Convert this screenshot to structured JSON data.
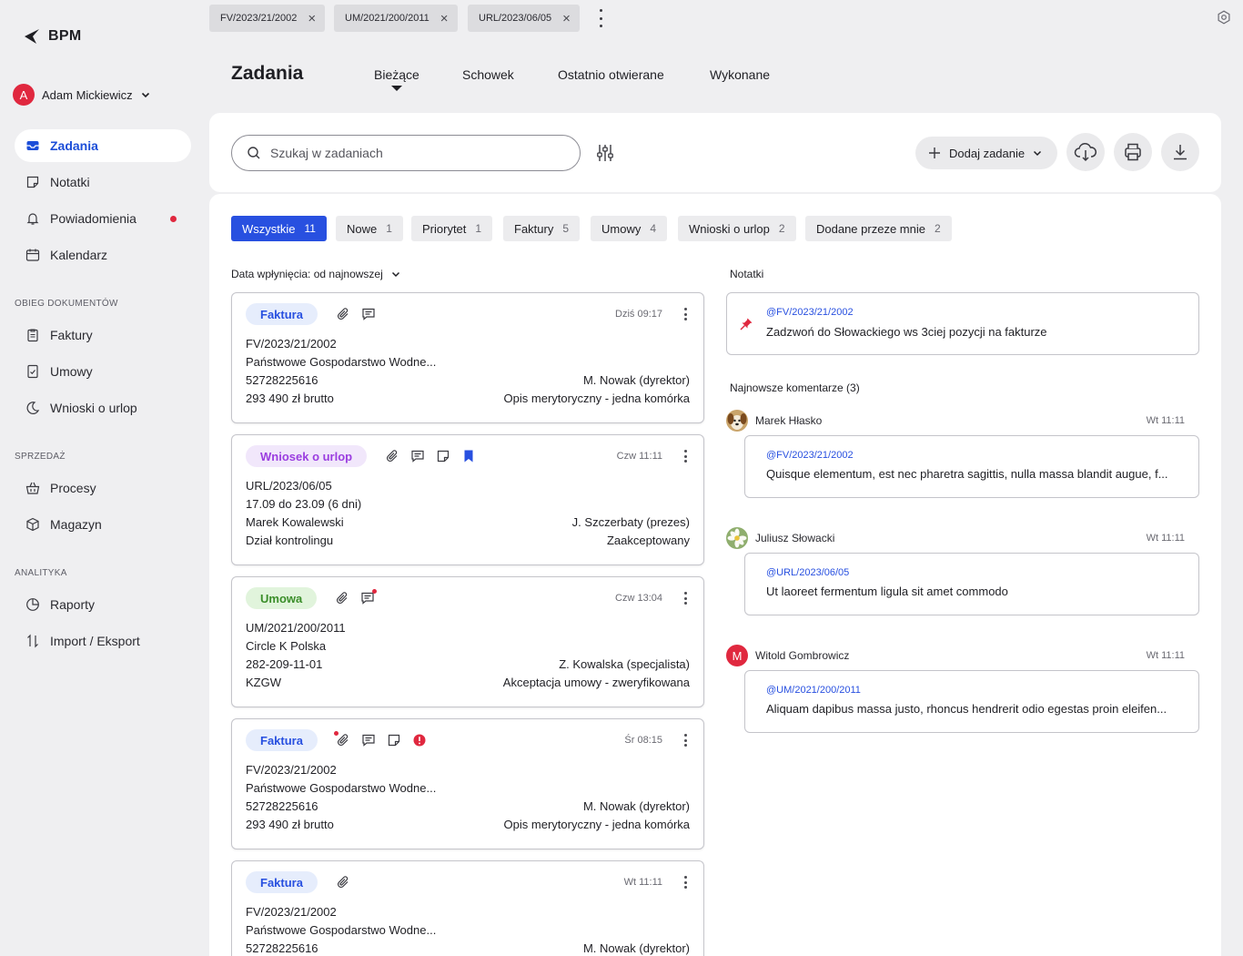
{
  "brand": {
    "name": "BPM",
    "accent": "#2850e0",
    "alert": "#e0283f"
  },
  "user": {
    "initial": "A",
    "name": "Adam Mickiewicz"
  },
  "nav": {
    "main": [
      {
        "label": "Zadania",
        "icon": "inbox-icon",
        "active": true
      },
      {
        "label": "Notatki",
        "icon": "note-icon"
      },
      {
        "label": "Powiadomienia",
        "icon": "bell-icon",
        "has_dot": true
      },
      {
        "label": "Kalendarz",
        "icon": "calendar-icon"
      }
    ],
    "sections": [
      {
        "title": "OBIEG DOKUMENTÓW",
        "items": [
          {
            "label": "Faktury",
            "icon": "clipboard-icon"
          },
          {
            "label": "Umowy",
            "icon": "check-document-icon"
          },
          {
            "label": "Wnioski o urlop",
            "icon": "moon-icon"
          }
        ]
      },
      {
        "title": "SPRZEDAŻ",
        "items": [
          {
            "label": "Procesy",
            "icon": "basket-icon"
          },
          {
            "label": "Magazyn",
            "icon": "box-icon"
          }
        ]
      },
      {
        "title": "ANALITYKA",
        "items": [
          {
            "label": "Raporty",
            "icon": "pie-chart-icon"
          },
          {
            "label": "Import / Eksport",
            "icon": "transfer-icon"
          }
        ]
      }
    ]
  },
  "doc_tabs": [
    "FV/2023/21/2002",
    "UM/2021/200/2011",
    "URL/2023/06/05"
  ],
  "header": {
    "title": "Zadania",
    "tabs": [
      "Bieżące",
      "Schowek",
      "Ostatnio otwierane",
      "Wykonane"
    ],
    "active_tab": "Bieżące"
  },
  "toolbar": {
    "search_placeholder": "Szukaj w zadaniach",
    "add_label": "Dodaj zadanie"
  },
  "filters": [
    {
      "label": "Wszystkie",
      "count": "11",
      "active": true
    },
    {
      "label": "Nowe",
      "count": "1"
    },
    {
      "label": "Priorytet",
      "count": "1"
    },
    {
      "label": "Faktury",
      "count": "5"
    },
    {
      "label": "Umowy",
      "count": "4"
    },
    {
      "label": "Wnioski o urlop",
      "count": "2"
    },
    {
      "label": "Dodane przeze mnie",
      "count": "2"
    }
  ],
  "sort_label": "Data wpłynięcia: od najnowszej",
  "tasks": [
    {
      "type": "Faktura",
      "icons": [
        "paperclip-icon",
        "comment-icon"
      ],
      "time": "Dziś 09:17",
      "lines": [
        [
          "FV/2023/21/2002",
          ""
        ],
        [
          "Państwowe Gospodarstwo Wodne...",
          ""
        ],
        [
          "52728225616",
          "M. Nowak (dyrektor)"
        ],
        [
          "293 490 zł brutto",
          "Opis merytoryczny - jedna komórka"
        ]
      ]
    },
    {
      "type": "Wniosek o urlop",
      "icons": [
        "paperclip-icon",
        "comment-icon",
        "note-icon",
        "bookmark-icon"
      ],
      "time": "Czw 11:11",
      "lines": [
        [
          "URL/2023/06/05",
          ""
        ],
        [
          "17.09 do 23.09 (6 dni)",
          ""
        ],
        [
          "Marek Kowalewski",
          "J. Szczerbaty (prezes)"
        ],
        [
          "Dział kontrolingu",
          "Zaakceptowany"
        ]
      ]
    },
    {
      "type": "Umowa",
      "icons": [
        "paperclip-icon",
        "comment-icon"
      ],
      "time": "Czw 13:04",
      "lines": [
        [
          "UM/2021/200/2011",
          ""
        ],
        [
          "Circle K Polska",
          ""
        ],
        [
          "282-209-11-01",
          "Z. Kowalska (specjalista)"
        ],
        [
          "KZGW",
          "Akceptacja umowy - zweryfikowana"
        ]
      ]
    },
    {
      "type": "Faktura",
      "icons": [
        "paperclip-icon",
        "comment-icon",
        "note-icon",
        "alert-icon"
      ],
      "time": "Śr 08:15",
      "lines": [
        [
          "FV/2023/21/2002",
          ""
        ],
        [
          "Państwowe Gospodarstwo Wodne...",
          ""
        ],
        [
          "52728225616",
          "M. Nowak (dyrektor)"
        ],
        [
          "293 490 zł brutto",
          "Opis merytoryczny - jedna komórka"
        ]
      ]
    },
    {
      "type": "Faktura",
      "icons": [
        "paperclip-icon"
      ],
      "time": "Wt 11:11",
      "lines": [
        [
          "FV/2023/21/2002",
          ""
        ],
        [
          "Państwowe Gospodarstwo Wodne...",
          ""
        ],
        [
          "52728225616",
          "M. Nowak (dyrektor)"
        ]
      ]
    }
  ],
  "notes": {
    "title": "Notatki",
    "items": [
      {
        "ref": "@FV/2023/21/2002",
        "text": "Zadzwoń do Słowackiego ws 3ciej pozycji na fakturze"
      }
    ]
  },
  "comments": {
    "title": "Najnowsze komentarze (3)",
    "items": [
      {
        "author": "Marek Hłasko",
        "avatar": "dog-photo",
        "time": "Wt 11:11",
        "ref": "@FV/2023/21/2002",
        "text": "Quisque elementum, est nec pharetra sagittis, nulla massa blandit augue, f..."
      },
      {
        "author": "Juliusz Słowacki",
        "avatar": "flower-photo",
        "time": "Wt 11:11",
        "ref": "@URL/2023/06/05",
        "text": "Ut laoreet fermentum ligula sit amet commodo"
      },
      {
        "author": "Witold Gombrowicz",
        "avatar": "initial",
        "initial": "M",
        "time": "Wt 11:11",
        "ref": "@UM/2021/200/2011",
        "text": "Aliquam dapibus massa justo, rhoncus hendrerit odio egestas proin eleifen..."
      }
    ]
  }
}
